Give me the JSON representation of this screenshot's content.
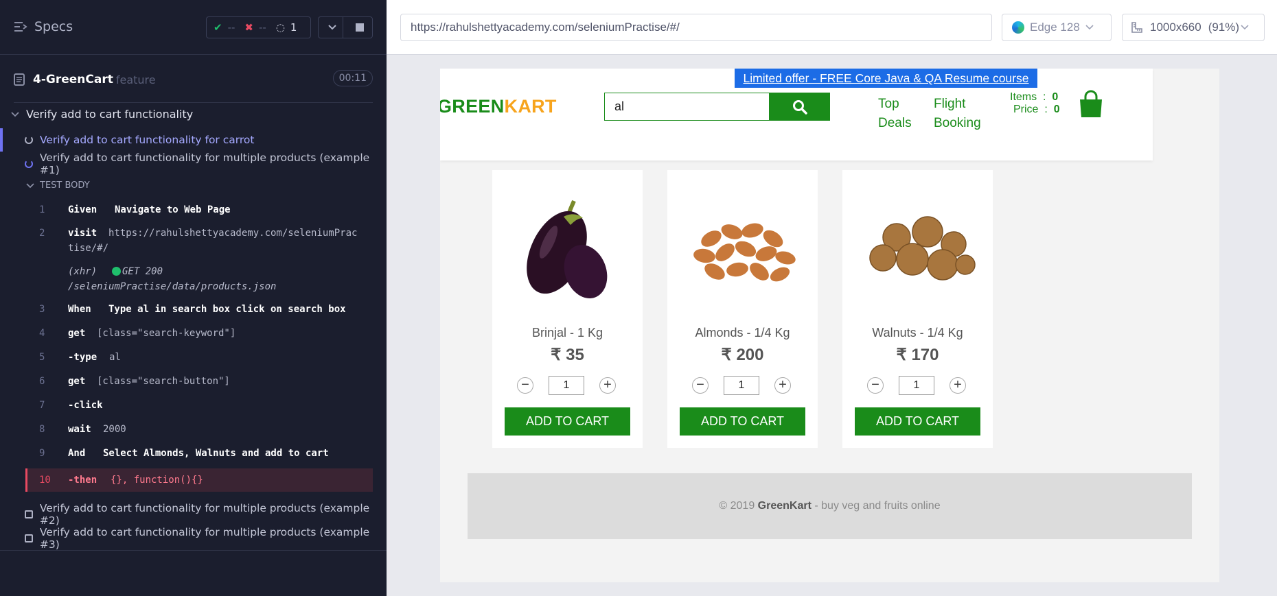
{
  "runner": {
    "specs_label": "Specs",
    "stats": {
      "passed": "--",
      "failed": "--",
      "pending": "1"
    },
    "file": {
      "name": "4-GreenCart",
      "ext": "feature",
      "time": "00:11"
    },
    "suite": "Verify add to cart functionality",
    "tests": [
      {
        "label": "Verify add to cart functionality for carrot",
        "state": "running"
      },
      {
        "label": "Verify add to cart functionality for multiple products (example #1)",
        "state": "running"
      },
      {
        "label": "Verify add to cart functionality for multiple products (example #2)",
        "state": "pending"
      },
      {
        "label": "Verify add to cart functionality for multiple products (example #3)",
        "state": "pending"
      }
    ],
    "test_body_label": "TEST BODY",
    "log": [
      {
        "num": "1",
        "cmd": "Given",
        "arg": "Navigate to Web Page"
      },
      {
        "num": "2",
        "cmd": "visit",
        "arg": "https://rahulshettyacademy.com/seleniumPrac",
        "arg2": "tise/#/"
      },
      {
        "xhr": "(xhr)",
        "method": "GET 200",
        "path": "/seleniumPractise/data/products.json"
      },
      {
        "num": "3",
        "cmd": "When",
        "arg": "Type al in search box click on search box"
      },
      {
        "num": "4",
        "cmd": "get",
        "arg": "[class=\"search-keyword\"]"
      },
      {
        "num": "5",
        "cmd": "-type",
        "arg": "al"
      },
      {
        "num": "6",
        "cmd": "get",
        "arg": "[class=\"search-button\"]"
      },
      {
        "num": "7",
        "cmd": "-click",
        "arg": ""
      },
      {
        "num": "8",
        "cmd": "wait",
        "arg": "2000"
      },
      {
        "num": "9",
        "cmd": "And",
        "arg": "Select Almonds, Walnuts and add to cart"
      },
      {
        "num": "10",
        "cmd": "-then",
        "arg": "{}, function(){}"
      }
    ]
  },
  "browser": {
    "url": "https://rahulshettyacademy.com/seleniumPractise/#/",
    "name": "Edge 128",
    "viewport": "1000x660",
    "scale": "(91%)"
  },
  "app": {
    "promo": "Limited offer - FREE Core Java & QA Resume course",
    "logo_green": "GREEN",
    "logo_orange": "KART",
    "search_value": "al",
    "nav": [
      [
        "Top",
        "Deals"
      ],
      [
        "Flight",
        "Booking"
      ]
    ],
    "items_label": "Items",
    "items_value": "0",
    "price_label": "Price",
    "price_value": "0",
    "products": [
      {
        "name": "Brinjal - 1 Kg",
        "price": "₹ 35",
        "qty": "1",
        "button": "ADD TO CART",
        "image": "brinjal"
      },
      {
        "name": "Almonds - 1/4 Kg",
        "price": "₹ 200",
        "qty": "1",
        "button": "ADD TO CART",
        "image": "almonds"
      },
      {
        "name": "Walnuts - 1/4 Kg",
        "price": "₹ 170",
        "qty": "1",
        "button": "ADD TO CART",
        "image": "walnuts"
      }
    ],
    "footer_pre": "© 2019 ",
    "footer_brand": "GreenKart",
    "footer_post": " - buy veg and fruits online"
  }
}
